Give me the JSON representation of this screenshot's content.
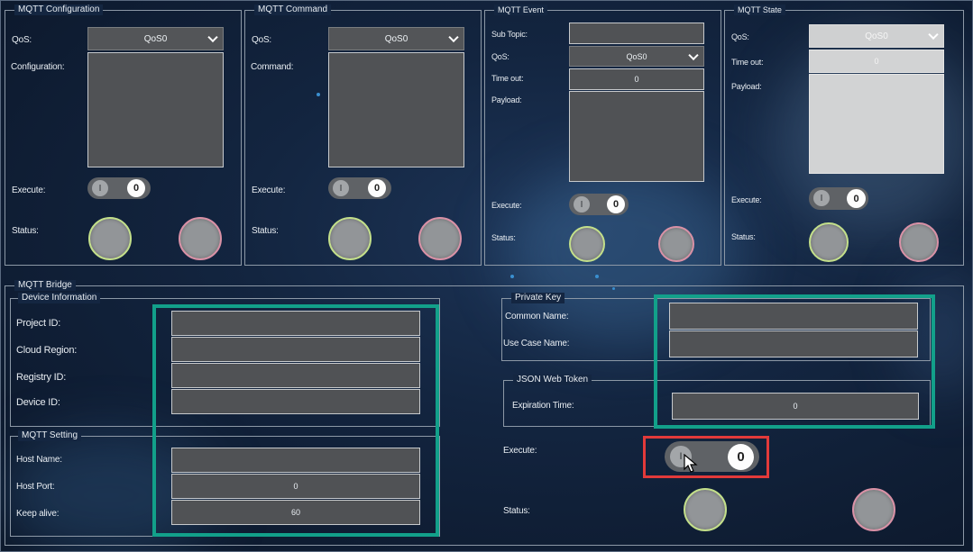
{
  "colors": {
    "highlight_teal": "#12a08a",
    "highlight_red": "#e23a3a",
    "status_ok": "#c3df8a",
    "status_err": "#d991a6"
  },
  "config": {
    "title": "MQTT Configuration",
    "qos_label": "QoS:",
    "qos_value": "QoS0",
    "config_label": "Configuration:",
    "execute_label": "Execute:",
    "status_label": "Status:",
    "toggle_left": "I",
    "toggle_right": "0"
  },
  "command": {
    "title": "MQTT Command",
    "qos_label": "QoS:",
    "qos_value": "QoS0",
    "command_label": "Command:",
    "execute_label": "Execute:",
    "status_label": "Status:",
    "toggle_left": "I",
    "toggle_right": "0"
  },
  "event": {
    "title": "MQTT Event",
    "subtopic_label": "Sub Topic:",
    "qos_label": "QoS:",
    "qos_value": "QoS0",
    "timeout_label": "Time out:",
    "timeout_value": "0",
    "payload_label": "Payload:",
    "execute_label": "Execute:",
    "status_label": "Status:",
    "toggle_left": "I",
    "toggle_right": "0"
  },
  "state": {
    "title": "MQTT State",
    "qos_label": "QoS:",
    "qos_value": "QoS0",
    "timeout_label": "Time out:",
    "timeout_value": "0",
    "payload_label": "Payload:",
    "execute_label": "Execute:",
    "status_label": "Status:",
    "toggle_left": "I",
    "toggle_right": "0"
  },
  "bridge": {
    "title": "MQTT Bridge",
    "device": {
      "title": "Device Information",
      "project_label": "Project ID:",
      "region_label": "Cloud Region:",
      "registry_label": "Registry ID:",
      "device_label": "Device ID:"
    },
    "setting": {
      "title": "MQTT Setting",
      "host_label": "Host Name:",
      "port_label": "Host Port:",
      "port_value": "0",
      "keepalive_label": "Keep alive:",
      "keepalive_value": "60"
    },
    "private_key": {
      "title": "Private Key",
      "common_label": "Common Name:",
      "usecase_label": "Use Case Name:"
    },
    "jwt": {
      "title": "JSON Web Token",
      "expiration_label": "Expiration Time:",
      "expiration_value": "0"
    },
    "execute_label": "Execute:",
    "status_label": "Status:",
    "toggle_left": "I",
    "toggle_right": "0"
  },
  "icons": {
    "chevron": "chevron-down-icon",
    "cursor": "mouse-pointer-icon"
  }
}
